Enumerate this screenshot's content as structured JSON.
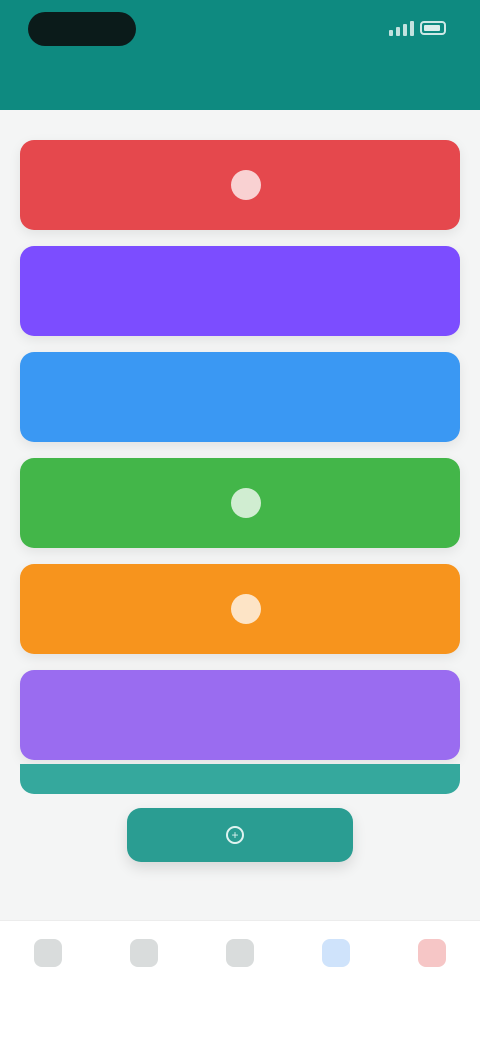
{
  "status_bar": {
    "clock": "",
    "icons": [
      "signal-icon",
      "wifi-icon",
      "battery-icon"
    ]
  },
  "header": {
    "title": ""
  },
  "menu": {
    "items": [
      {
        "label": "",
        "color": "#e5484d",
        "icon": "circle-icon"
      },
      {
        "label": "",
        "color": "#7c4dff",
        "icon": ""
      },
      {
        "label": "",
        "color": "#3a98f3",
        "icon": ""
      },
      {
        "label": "",
        "color": "#43b649",
        "icon": "circle-icon"
      },
      {
        "label": "",
        "color": "#f7941d",
        "icon": "circle-icon"
      },
      {
        "label": "",
        "color": "#9a6cf0",
        "icon": ""
      }
    ]
  },
  "fab": {
    "label": "",
    "icon": "plus-icon"
  },
  "footer_note": "",
  "bottom_nav": {
    "items": [
      {
        "label": "",
        "icon": "home-icon"
      },
      {
        "label": "",
        "icon": "list-icon"
      },
      {
        "label": "",
        "icon": "grid-icon"
      },
      {
        "label": "",
        "icon": "chart-icon",
        "active": true
      },
      {
        "label": "",
        "icon": "profile-icon"
      }
    ]
  },
  "colors": {
    "primary": "#0e8a80",
    "accent_active": "#5b9be8",
    "page_bg": "#f4f5f5"
  }
}
